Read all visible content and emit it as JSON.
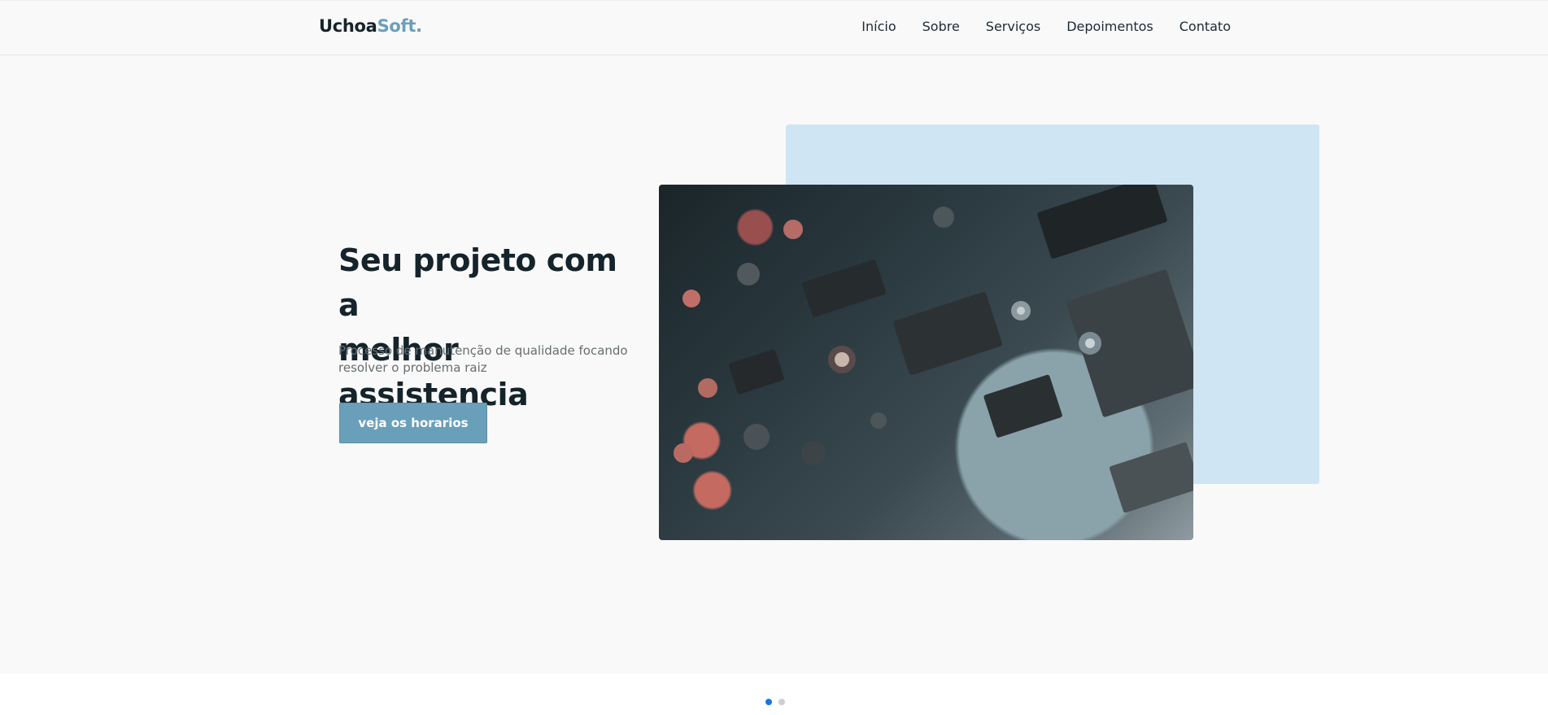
{
  "brand": {
    "name_main": "Uchoa",
    "name_accent": "Soft",
    "name_dot": ".",
    "accent_color": "#6a9fba"
  },
  "nav": {
    "items": [
      "Início",
      "Sobre",
      "Serviços",
      "Depoimentos",
      "Contato"
    ]
  },
  "hero": {
    "title_line1": "Seu projeto com a",
    "title_line2": "melhor assistencia",
    "subtitle": "Processo de manutenção de qualidade focando resolver o problema raiz",
    "cta_label": "veja os horarios",
    "image_icon": "circuit-board-photo",
    "block_color": "#cfe5f3"
  },
  "carousel": {
    "slides": 2,
    "active": 1,
    "active_color": "#1a73e8"
  }
}
